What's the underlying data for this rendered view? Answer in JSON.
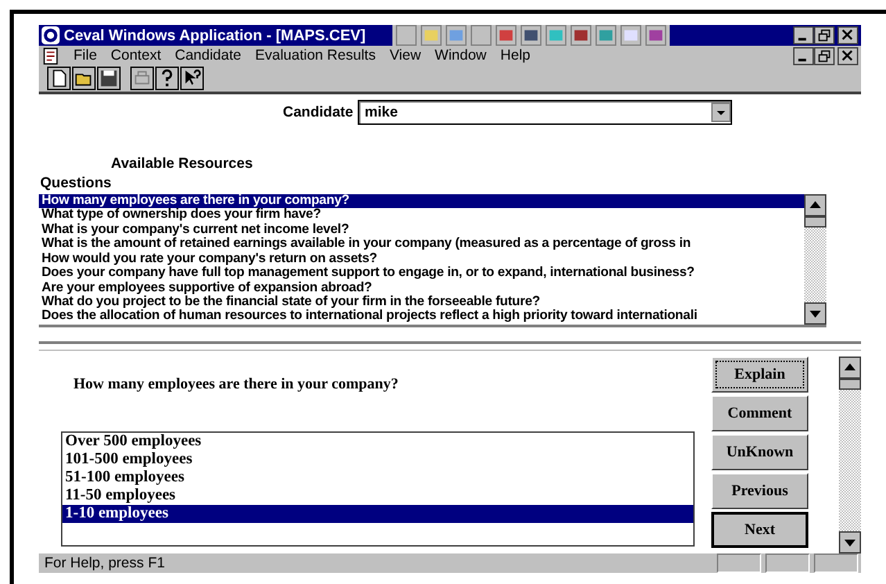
{
  "window": {
    "title": "Ceval Windows Application - [MAPS.CEV]"
  },
  "menu": [
    {
      "label": "File"
    },
    {
      "label": "Context"
    },
    {
      "label": "Candidate"
    },
    {
      "label": "Evaluation Results"
    },
    {
      "label": "View"
    },
    {
      "label": "Window"
    },
    {
      "label": "Help"
    }
  ],
  "candidate": {
    "label": "Candidate",
    "value": "mike"
  },
  "resources_heading": "Available Resources",
  "questions": {
    "label": "Questions",
    "items": [
      {
        "text": "How many employees are there in your company?",
        "selected": true
      },
      {
        "text": "What type of ownership does your firm have?",
        "selected": false
      },
      {
        "text": "What is your company's current net income level?",
        "selected": false
      },
      {
        "text": "What is the amount of retained earnings available in your company  (measured as a percentage of gross in",
        "selected": false
      },
      {
        "text": "How would you rate your company's return on assets?",
        "selected": false
      },
      {
        "text": "Does your company have full top management support to engage in, or to expand, international business?",
        "selected": false
      },
      {
        "text": "Are your employees supportive of expansion abroad?",
        "selected": false
      },
      {
        "text": "What do you project to be the financial state of your firm in the forseeable future?",
        "selected": false
      },
      {
        "text": "Does the allocation of human resources to international projects  reflect a high priority toward internationali",
        "selected": false
      }
    ]
  },
  "prompt": "How many employees are there in your company?",
  "answers": [
    {
      "text": "Over 500 employees",
      "selected": false
    },
    {
      "text": "101-500 employees",
      "selected": false
    },
    {
      "text": "51-100 employees",
      "selected": false
    },
    {
      "text": "11-50 employees",
      "selected": false
    },
    {
      "text": "1-10 employees",
      "selected": true
    }
  ],
  "buttons": [
    {
      "label": "Explain",
      "focused": true,
      "default": false
    },
    {
      "label": "Comment",
      "focused": false,
      "default": false
    },
    {
      "label": "UnKnown",
      "focused": false,
      "default": false
    },
    {
      "label": "Previous",
      "focused": false,
      "default": false
    },
    {
      "label": "Next",
      "focused": false,
      "default": true
    }
  ],
  "status_bar": {
    "text": "For Help, press F1"
  }
}
